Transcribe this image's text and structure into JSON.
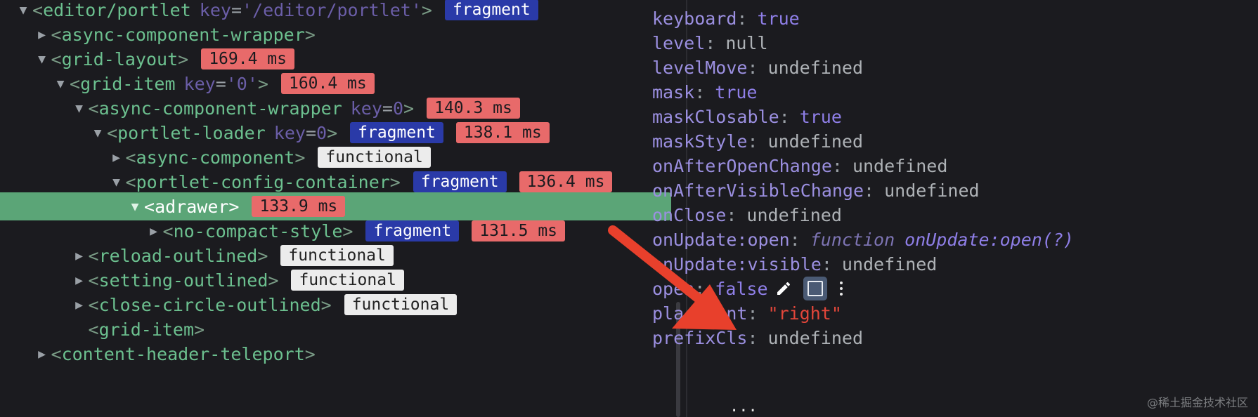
{
  "tree": [
    {
      "depth": 0,
      "arrow": "▼",
      "tag": "editor/portlet",
      "attrs": [
        {
          "k": "key",
          "v": "'/editor/portlet'"
        }
      ],
      "badges": [
        {
          "kind": "fragment",
          "text": "fragment"
        }
      ]
    },
    {
      "depth": 1,
      "arrow": "▶",
      "tag": "async-component-wrapper",
      "attrs": [],
      "badges": []
    },
    {
      "depth": 1,
      "arrow": "▼",
      "tag": "grid-layout",
      "attrs": [],
      "badges": [
        {
          "kind": "time",
          "text": "169.4 ms"
        }
      ]
    },
    {
      "depth": 2,
      "arrow": "▼",
      "tag": "grid-item",
      "attrs": [
        {
          "k": "key",
          "v": "'0'"
        }
      ],
      "badges": [
        {
          "kind": "time",
          "text": "160.4 ms"
        }
      ]
    },
    {
      "depth": 3,
      "arrow": "▼",
      "tag": "async-component-wrapper",
      "attrs": [
        {
          "k": "key",
          "v": "0"
        }
      ],
      "badges": [
        {
          "kind": "time",
          "text": "140.3 ms"
        }
      ]
    },
    {
      "depth": 4,
      "arrow": "▼",
      "tag": "portlet-loader",
      "attrs": [
        {
          "k": "key",
          "v": "0"
        }
      ],
      "badges": [
        {
          "kind": "fragment",
          "text": "fragment"
        },
        {
          "kind": "time",
          "text": "138.1 ms"
        }
      ]
    },
    {
      "depth": 5,
      "arrow": "▶",
      "tag": "async-component",
      "attrs": [],
      "badges": [
        {
          "kind": "func",
          "text": "functional"
        }
      ]
    },
    {
      "depth": 5,
      "arrow": "▼",
      "tag": "portlet-config-container",
      "attrs": [],
      "badges": [
        {
          "kind": "fragment",
          "text": "fragment"
        },
        {
          "kind": "time",
          "text": "136.4 ms"
        }
      ]
    },
    {
      "depth": 6,
      "arrow": "▼",
      "tag": "adrawer",
      "attrs": [],
      "badges": [
        {
          "kind": "time",
          "text": "133.9 ms"
        }
      ],
      "selected": true
    },
    {
      "depth": 7,
      "arrow": "▶",
      "tag": "no-compact-style",
      "attrs": [],
      "badges": [
        {
          "kind": "fragment",
          "text": "fragment"
        },
        {
          "kind": "time",
          "text": "131.5 ms"
        }
      ]
    },
    {
      "depth": 3,
      "arrow": "▶",
      "tag": "reload-outlined",
      "attrs": [],
      "badges": [
        {
          "kind": "func",
          "text": "functional"
        }
      ]
    },
    {
      "depth": 3,
      "arrow": "▶",
      "tag": "setting-outlined",
      "attrs": [],
      "badges": [
        {
          "kind": "func",
          "text": "functional"
        }
      ]
    },
    {
      "depth": 3,
      "arrow": "▶",
      "tag": "close-circle-outlined",
      "attrs": [],
      "badges": [
        {
          "kind": "func",
          "text": "functional"
        }
      ]
    },
    {
      "depth": 3,
      "arrow": "",
      "tag": "grid-item",
      "attrs": [],
      "badges": []
    },
    {
      "depth": 1,
      "arrow": "▶",
      "tag": "content-header-teleport",
      "attrs": [],
      "badges": []
    }
  ],
  "props": [
    {
      "key": "keyboard",
      "value": "true",
      "type": "bool"
    },
    {
      "key": "level",
      "value": "null",
      "type": "null"
    },
    {
      "key": "levelMove",
      "value": "undefined",
      "type": "undef"
    },
    {
      "key": "mask",
      "value": "true",
      "type": "bool"
    },
    {
      "key": "maskClosable",
      "value": "true",
      "type": "bool"
    },
    {
      "key": "maskStyle",
      "value": "undefined",
      "type": "undef"
    },
    {
      "key": "onAfterOpenChange",
      "value": "undefined",
      "type": "undef"
    },
    {
      "key": "onAfterVisibleChange",
      "value": "undefined",
      "type": "undef"
    },
    {
      "key": "onClose",
      "value": "undefined",
      "type": "undef"
    },
    {
      "key": "onUpdate:open",
      "type": "fn",
      "fn_keyword": "function",
      "value": "onUpdate:open(?)"
    },
    {
      "key": "onUpdate:visible",
      "value": "undefined",
      "type": "undef"
    },
    {
      "key": "open",
      "value": "false",
      "type": "bool",
      "editable": true
    },
    {
      "key": "placement",
      "value": "\"right\"",
      "type": "str"
    },
    {
      "key": "prefixCls",
      "value": "undefined",
      "type": "undef"
    }
  ],
  "ellipsis": "...",
  "watermark": "@稀土掘金技术社区",
  "colors": {
    "selected_row": "#5ba577",
    "time_badge": "#e86a6a",
    "fragment_badge": "#2a3aa8",
    "arrow": "#e8402c"
  }
}
